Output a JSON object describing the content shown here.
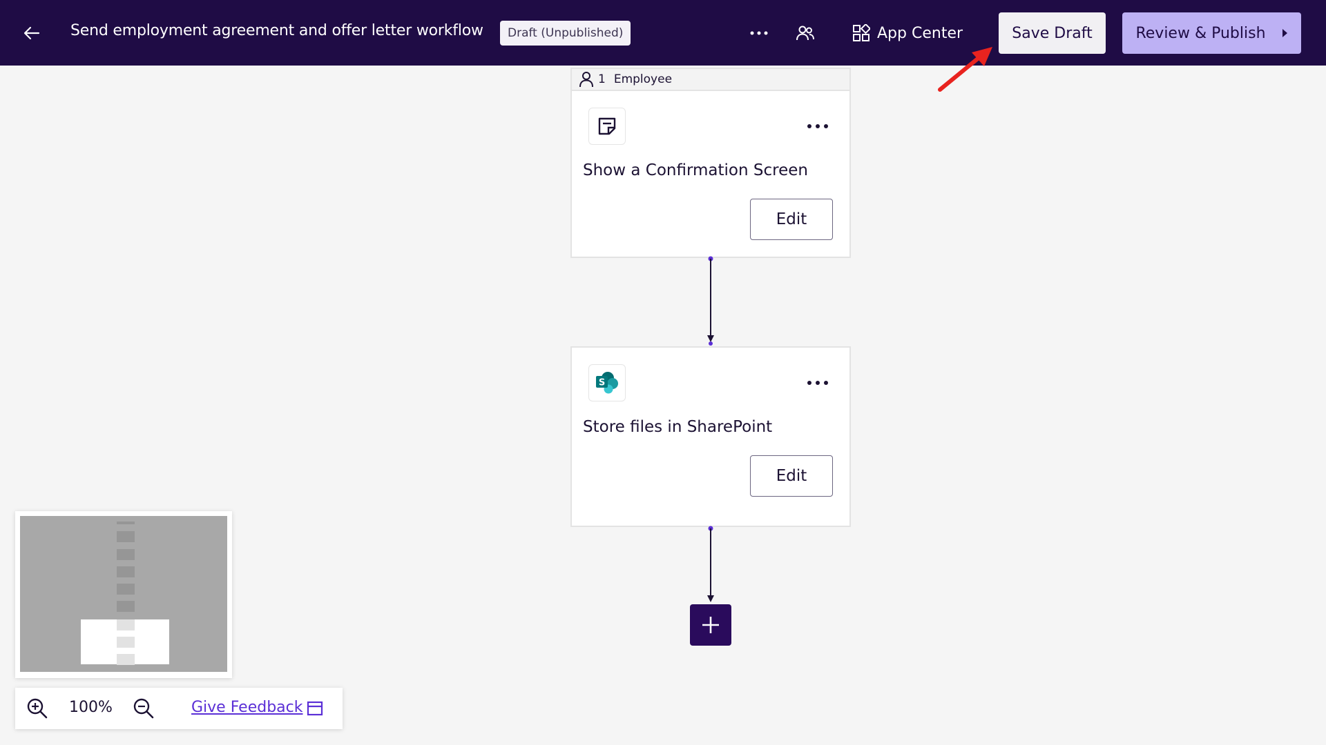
{
  "header": {
    "title": "Send employment agreement and offer letter workflow",
    "status_badge": "Draft (Unpublished)",
    "app_center_label": "App Center",
    "save_draft_label": "Save Draft",
    "review_publish_label": "Review & Publish",
    "icons": [
      "arrow-left-icon",
      "more-horizontal-icon",
      "people-icon",
      "grid-icon",
      "caret-right-icon"
    ],
    "background_color": "#1f0c45",
    "publish_color": "#bdb1f4"
  },
  "workflow": {
    "role": {
      "count": "1",
      "label": "Employee"
    },
    "steps": [
      {
        "title": "Show a Confirmation Screen",
        "icon": "confirmation-screen-icon",
        "edit_label": "Edit"
      },
      {
        "title": "Store files in SharePoint",
        "icon": "sharepoint-icon",
        "edit_label": "Edit"
      }
    ],
    "add_step_icon": "plus-icon",
    "accent_color": "#2a0b5c"
  },
  "zoom": {
    "level": "100%",
    "feedback_label": "Give Feedback"
  },
  "annotation": {
    "color": "#e8231f"
  }
}
